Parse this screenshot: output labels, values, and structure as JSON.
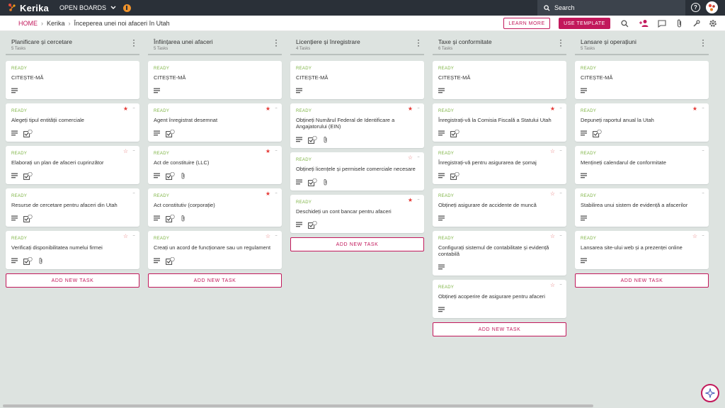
{
  "app": {
    "logo_text": "Kerika",
    "open_boards": "OPEN BOARDS",
    "search_placeholder": "Search"
  },
  "breadcrumb": {
    "home": "HOME",
    "org": "Kerika",
    "board": "Începerea unei noi afaceri în Utah"
  },
  "toolbar": {
    "learn_more": "LEARN MORE",
    "use_template": "USE TEMPLATE"
  },
  "colors": {
    "accent": "#c2185b",
    "ready": "#7cb342",
    "star": "#e53935"
  },
  "add_task_label": "ADD NEW TASK",
  "columns": [
    {
      "title": "Planificare și cercetare",
      "count": "5 Tasks",
      "cards": [
        {
          "status": "READY",
          "title": "CITEȘTE-MĂ",
          "star": "none",
          "icons": [
            "desc"
          ]
        },
        {
          "status": "READY",
          "title": "Alegeți tipul entității comerciale",
          "star": "on",
          "icons": [
            "desc",
            "tasks"
          ]
        },
        {
          "status": "READY",
          "title": "Elaborați un plan de afaceri cuprinzător",
          "star": "off",
          "icons": [
            "desc",
            "tasks"
          ]
        },
        {
          "status": "READY",
          "title": "Resurse de cercetare pentru afaceri din Utah",
          "star": "none",
          "icons": [
            "desc",
            "tasks"
          ]
        },
        {
          "status": "READY",
          "title": "Verificați disponibilitatea numelui firmei",
          "star": "off",
          "icons": [
            "desc",
            "tasks",
            "attach"
          ]
        }
      ]
    },
    {
      "title": "Înființarea unei afaceri",
      "count": "5 Tasks",
      "cards": [
        {
          "status": "READY",
          "title": "CITEȘTE-MĂ",
          "star": "none",
          "icons": [
            "desc"
          ]
        },
        {
          "status": "READY",
          "title": "Agent înregistrat desemnat",
          "star": "on",
          "icons": [
            "desc",
            "tasks"
          ]
        },
        {
          "status": "READY",
          "title": "Act de constituire (LLC)",
          "star": "on",
          "icons": [
            "desc",
            "tasks",
            "attach"
          ]
        },
        {
          "status": "READY",
          "title": "Act constitutiv (corporație)",
          "star": "on",
          "icons": [
            "desc",
            "tasks",
            "attach"
          ]
        },
        {
          "status": "READY",
          "title": "Creați un acord de funcționare sau un regulament",
          "star": "off",
          "icons": [
            "desc",
            "tasks"
          ]
        }
      ]
    },
    {
      "title": "Licențiere și înregistrare",
      "count": "4 Tasks",
      "cards": [
        {
          "status": "READY",
          "title": "CITEȘTE-MĂ",
          "star": "none",
          "icons": [
            "desc"
          ]
        },
        {
          "status": "READY",
          "title": "Obțineți Numărul Federal de Identificare a Angajatorului (EIN)",
          "star": "on",
          "icons": [
            "desc",
            "tasks",
            "attach"
          ]
        },
        {
          "status": "READY",
          "title": "Obțineți licențele și permisele comerciale necesare",
          "star": "off",
          "icons": [
            "desc",
            "tasks",
            "attach"
          ]
        },
        {
          "status": "READY",
          "title": "Deschideți un cont bancar pentru afaceri",
          "star": "on",
          "icons": [
            "desc",
            "tasks"
          ]
        }
      ]
    },
    {
      "title": "Taxe și conformitate",
      "count": "6 Tasks",
      "cards": [
        {
          "status": "READY",
          "title": "CITEȘTE-MĂ",
          "star": "none",
          "icons": [
            "desc"
          ]
        },
        {
          "status": "READY",
          "title": "Înregistrați-vă la Comisia Fiscală a Statului Utah",
          "star": "on",
          "icons": [
            "desc",
            "tasks"
          ]
        },
        {
          "status": "READY",
          "title": "Înregistrați-vă pentru asigurarea de șomaj",
          "star": "off",
          "icons": [
            "desc",
            "tasks"
          ]
        },
        {
          "status": "READY",
          "title": "Obțineți asigurare de accidente de muncă",
          "star": "off",
          "icons": [
            "desc"
          ]
        },
        {
          "status": "READY",
          "title": "Configurați sistemul de contabilitate și evidență contabilă",
          "star": "off",
          "icons": [
            "desc"
          ]
        },
        {
          "status": "READY",
          "title": "Obțineți acoperire de asigurare pentru afaceri",
          "star": "off",
          "icons": [
            "desc"
          ]
        }
      ]
    },
    {
      "title": "Lansare și operațiuni",
      "count": "5 Tasks",
      "cards": [
        {
          "status": "READY",
          "title": "CITEȘTE-MĂ",
          "star": "none",
          "icons": [
            "desc"
          ]
        },
        {
          "status": "READY",
          "title": "Depuneți raportul anual la Utah",
          "star": "on",
          "icons": [
            "desc",
            "tasks"
          ]
        },
        {
          "status": "READY",
          "title": "Mențineți calendarul de conformitate",
          "star": "none",
          "icons": [
            "desc"
          ]
        },
        {
          "status": "READY",
          "title": "Stabilirea unui sistem de evidență a afacerilor",
          "star": "none",
          "icons": [
            "desc"
          ]
        },
        {
          "status": "READY",
          "title": "Lansarea site-ului web și a prezenței online",
          "star": "off",
          "icons": [
            "desc"
          ]
        }
      ]
    }
  ]
}
